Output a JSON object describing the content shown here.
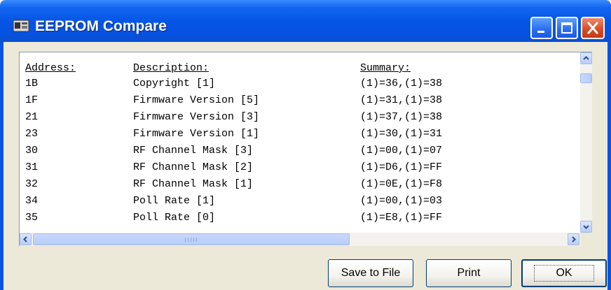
{
  "window": {
    "title": "EEPROM Compare",
    "icons": {
      "app": "app-icon",
      "minimize": "minimize-icon",
      "maximize": "maximize-icon",
      "close": "close-icon"
    },
    "colors": {
      "titlebar": "#0655e6",
      "close": "#d84a22",
      "client": "#ece9d8"
    }
  },
  "table": {
    "headers": {
      "address": "Address:",
      "description": "Description:",
      "summary": "Summary:"
    },
    "rows": [
      {
        "address": "1B",
        "description": "Copyright [1]",
        "summary": "(1)=36,(1)=38"
      },
      {
        "address": "1F",
        "description": "Firmware Version [5]",
        "summary": "(1)=31,(1)=38"
      },
      {
        "address": "21",
        "description": "Firmware Version [3]",
        "summary": "(1)=37,(1)=38"
      },
      {
        "address": "23",
        "description": "Firmware Version [1]",
        "summary": "(1)=30,(1)=31"
      },
      {
        "address": "30",
        "description": "RF Channel Mask [3]",
        "summary": "(1)=00,(1)=07"
      },
      {
        "address": "31",
        "description": "RF Channel Mask [2]",
        "summary": "(1)=D6,(1)=FF"
      },
      {
        "address": "32",
        "description": "RF Channel Mask [1]",
        "summary": "(1)=0E,(1)=F8"
      },
      {
        "address": "34",
        "description": "Poll Rate [1]",
        "summary": "(1)=00,(1)=03"
      },
      {
        "address": "35",
        "description": "Poll Rate [0]",
        "summary": "(1)=E8,(1)=FF"
      }
    ]
  },
  "scrollbars": {
    "icons": {
      "up": "chevron-up-icon",
      "down": "chevron-down-icon",
      "left": "chevron-left-icon",
      "right": "chevron-right-icon"
    }
  },
  "buttons": {
    "save_label": "Save to File",
    "print_label": "Print",
    "ok_label": "OK"
  }
}
